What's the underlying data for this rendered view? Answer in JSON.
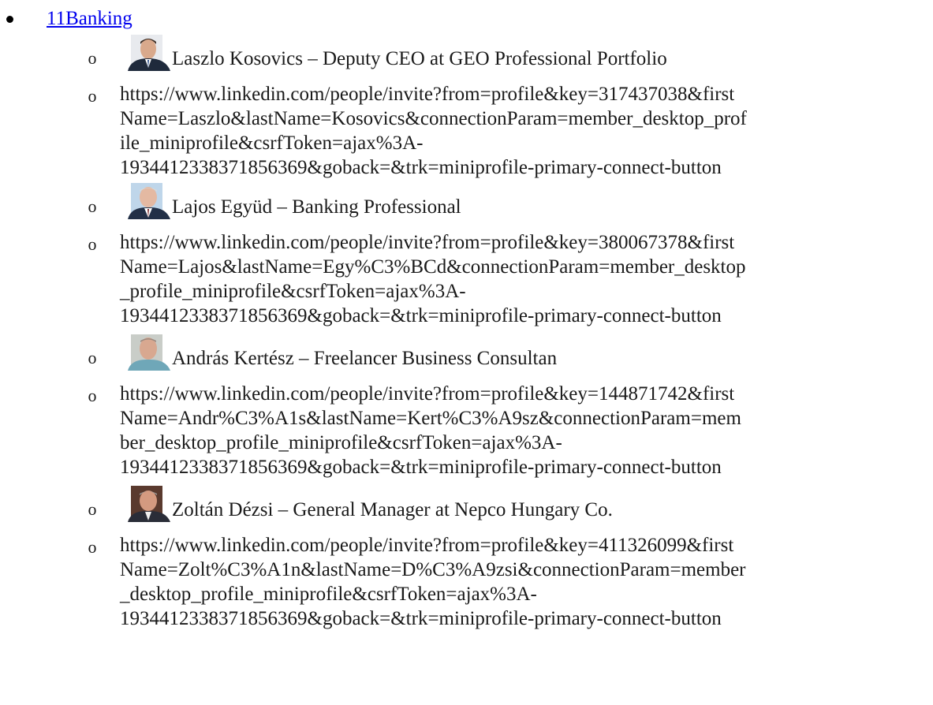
{
  "section": {
    "link_label": "11Banking"
  },
  "people": [
    {
      "name_line": "Laszlo Kosovics – Deputy CEO  at GEO Professional Portfolio",
      "avatar_icon": "person-photo-icon",
      "url_lines": [
        "https://www.linkedin.com/people/invite?from=profile&key=317437038&first",
        "Name=Laszlo&lastName=Kosovics&connectionParam=member_desktop_prof",
        "ile_miniprofile&csrfToken=ajax%3A-",
        "1934412338371856369&goback=&trk=miniprofile-primary-connect-button"
      ]
    },
    {
      "name_line": "Lajos Együd – Banking Professional",
      "avatar_icon": "person-photo-icon",
      "url_lines": [
        "https://www.linkedin.com/people/invite?from=profile&key=380067378&first",
        "Name=Lajos&lastName=Egy%C3%BCd&connectionParam=member_desktop",
        "_profile_miniprofile&csrfToken=ajax%3A-",
        "1934412338371856369&goback=&trk=miniprofile-primary-connect-button"
      ]
    },
    {
      "name_line": "András Kertész – Freelancer Business Consultan",
      "avatar_icon": "person-photo-icon",
      "url_lines": [
        "https://www.linkedin.com/people/invite?from=profile&key=144871742&first",
        "Name=Andr%C3%A1s&lastName=Kert%C3%A9sz&connectionParam=mem",
        "ber_desktop_profile_miniprofile&csrfToken=ajax%3A-",
        "1934412338371856369&goback=&trk=miniprofile-primary-connect-button"
      ]
    },
    {
      "name_line": "Zoltán Dézsi – General Manager at Nepco Hungary Co.",
      "avatar_icon": "person-photo-icon",
      "url_lines": [
        "https://www.linkedin.com/people/invite?from=profile&key=411326099&first",
        "Name=Zolt%C3%A1n&lastName=D%C3%A9zsi&connectionParam=member",
        "_desktop_profile_miniprofile&csrfToken=ajax%3A-",
        "1934412338371856369&goback=&trk=miniprofile-primary-connect-button"
      ]
    }
  ],
  "markers": {
    "bullet": "•",
    "sub_bullet": "o"
  }
}
